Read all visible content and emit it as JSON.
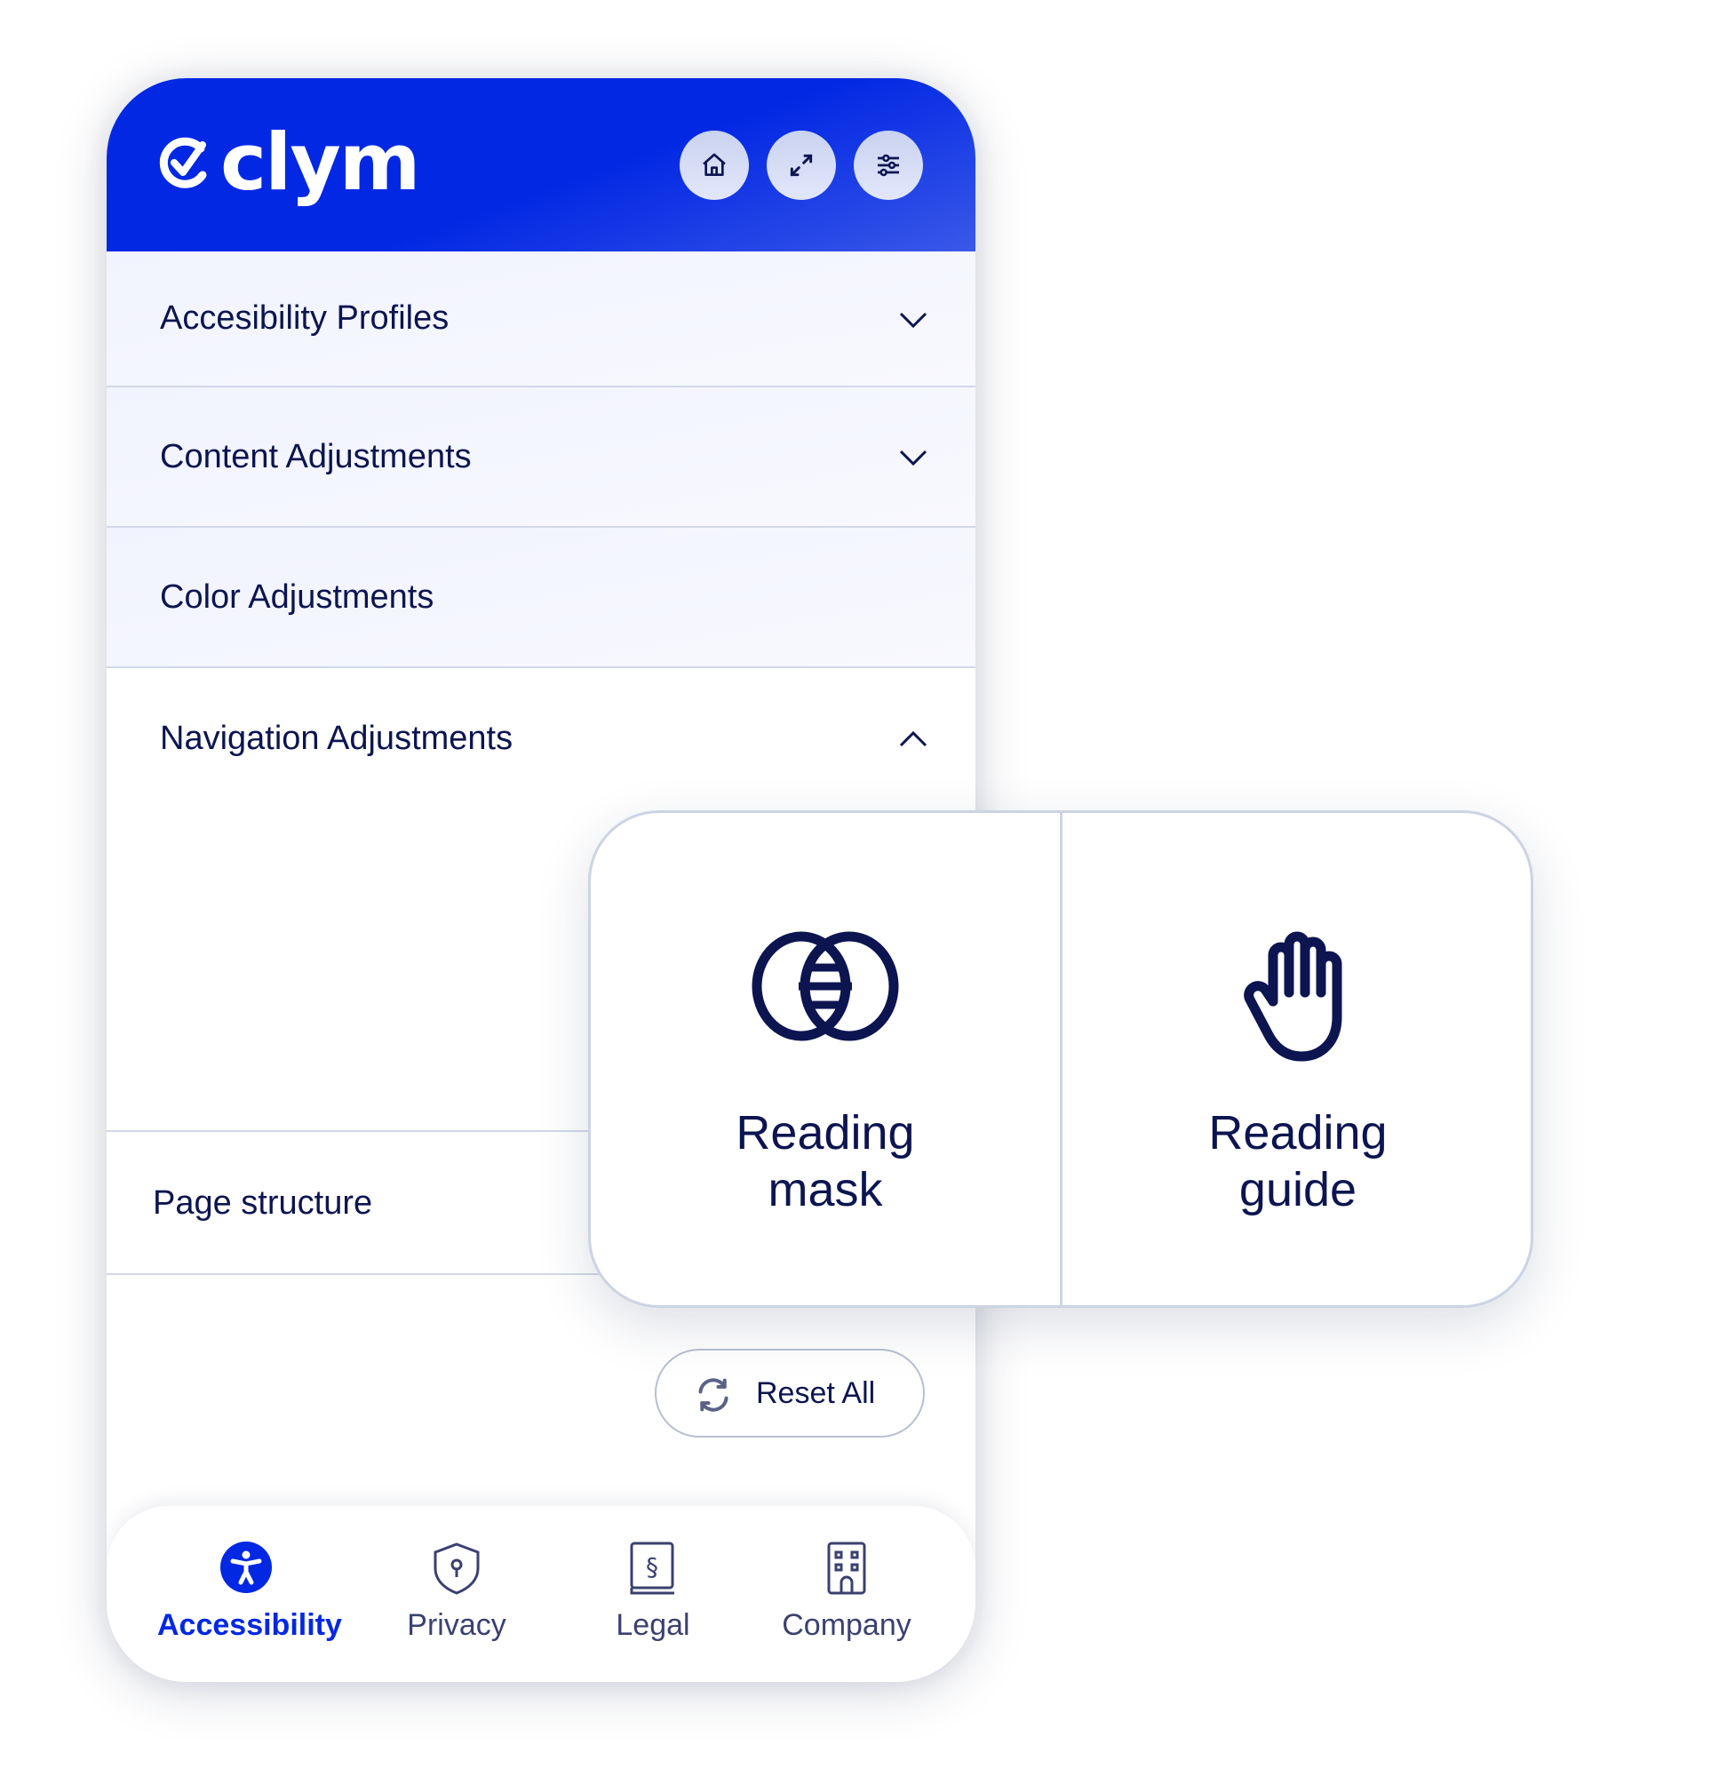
{
  "brand": {
    "name": "clym",
    "accent": "#0228e4",
    "text_color": "#0c1550"
  },
  "header": {
    "buttons": [
      {
        "icon": "home-icon",
        "label": "Home"
      },
      {
        "icon": "expand-icon",
        "label": "Expand"
      },
      {
        "icon": "sliders-icon",
        "label": "Settings"
      }
    ]
  },
  "sections": [
    {
      "label": "Accesibility Profiles",
      "state": "collapsed",
      "chevron": "chevron-down-icon"
    },
    {
      "label": "Content Adjustments",
      "state": "collapsed",
      "chevron": "chevron-down-icon"
    },
    {
      "label": "Color Adjustments",
      "state": "collapsed"
    },
    {
      "label": "Navigation Adjustments",
      "state": "expanded",
      "chevron": "chevron-up-icon"
    }
  ],
  "page_structure": {
    "label": "Page structure"
  },
  "navigation_tools": [
    {
      "label": "Reading mask",
      "line1": "Reading",
      "line2": "mask",
      "icon": "reading-mask-icon"
    },
    {
      "label": "Reading guide",
      "line1": "Reading",
      "line2": "guide",
      "icon": "hand-icon"
    }
  ],
  "reset": {
    "label": "Reset All",
    "icon": "refresh-icon"
  },
  "bottom_nav": {
    "active": "Accessibility",
    "items": [
      {
        "label": "Accessibility",
        "icon": "accessibility-icon"
      },
      {
        "label": "Privacy",
        "icon": "shield-keyhole-icon"
      },
      {
        "label": "Legal",
        "icon": "legal-book-icon"
      },
      {
        "label": "Company",
        "icon": "building-icon"
      }
    ]
  }
}
